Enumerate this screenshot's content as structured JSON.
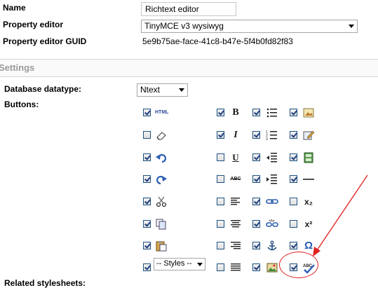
{
  "fields": {
    "name_label": "Name",
    "name_value": "Richtext editor",
    "property_editor_label": "Property editor",
    "property_editor_value": "TinyMCE v3 wysiwyg",
    "guid_label": "Property editor GUID",
    "guid_value": "5e9b75ae-face-41c8-b47e-5f4b0fd82f83"
  },
  "settings": {
    "title": "Settings",
    "datatype_label": "Database datatype:",
    "datatype_value": "Ntext",
    "buttons_label": "Buttons:",
    "related_label": "Related stylesheets:",
    "styles_select_value": "-- Styles --"
  },
  "buttons": [
    {
      "icon": "html-icon",
      "text": "HTML",
      "checked": true
    },
    {
      "icon": "bold-icon",
      "text": "B",
      "checked": true
    },
    {
      "icon": "unordered-list-icon",
      "text": "",
      "checked": true
    },
    {
      "icon": "image-icon",
      "text": "",
      "checked": true
    },
    {
      "icon": "remove-format-icon",
      "text": "",
      "checked": false
    },
    {
      "icon": "italic-icon",
      "text": "I",
      "checked": true
    },
    {
      "icon": "ordered-list-icon",
      "text": "",
      "checked": true
    },
    {
      "icon": "edit-icon",
      "text": "",
      "checked": true
    },
    {
      "icon": "undo-icon",
      "text": "",
      "checked": true
    },
    {
      "icon": "underline-icon",
      "text": "U",
      "checked": false
    },
    {
      "icon": "outdent-icon",
      "text": "",
      "checked": true
    },
    {
      "icon": "media-icon",
      "text": "",
      "checked": true
    },
    {
      "icon": "redo-icon",
      "text": "",
      "checked": true
    },
    {
      "icon": "strikethrough-icon",
      "text": "ABC",
      "checked": false
    },
    {
      "icon": "indent-icon",
      "text": "",
      "checked": true
    },
    {
      "icon": "horizontal-rule-icon",
      "text": "",
      "checked": true
    },
    {
      "icon": "cut-icon",
      "text": "",
      "checked": true
    },
    {
      "icon": "align-left-icon",
      "text": "",
      "checked": false
    },
    {
      "icon": "link-icon",
      "text": "",
      "checked": true
    },
    {
      "icon": "subscript-icon",
      "text": "x₂",
      "checked": false
    },
    {
      "icon": "copy-icon",
      "text": "",
      "checked": true
    },
    {
      "icon": "align-center-icon",
      "text": "",
      "checked": false
    },
    {
      "icon": "unlink-icon",
      "text": "",
      "checked": true
    },
    {
      "icon": "superscript-icon",
      "text": "x²",
      "checked": false
    },
    {
      "icon": "paste-icon",
      "text": "",
      "checked": true
    },
    {
      "icon": "align-right-icon",
      "text": "",
      "checked": false
    },
    {
      "icon": "anchor-icon",
      "text": "",
      "checked": true
    },
    {
      "icon": "special-char-icon",
      "text": "Ω",
      "checked": true
    },
    {
      "icon": "styles-select",
      "text": "",
      "checked": true
    },
    {
      "icon": "align-justify-icon",
      "text": "",
      "checked": false
    },
    {
      "icon": "insert-image-icon",
      "text": "",
      "checked": true
    },
    {
      "icon": "spellcheck-icon",
      "text": "ABC",
      "checked": true
    }
  ],
  "colors": {
    "annotation": "#e02020",
    "checkbox_border": "#1c5180",
    "settings_title": "#9a9a9a"
  }
}
